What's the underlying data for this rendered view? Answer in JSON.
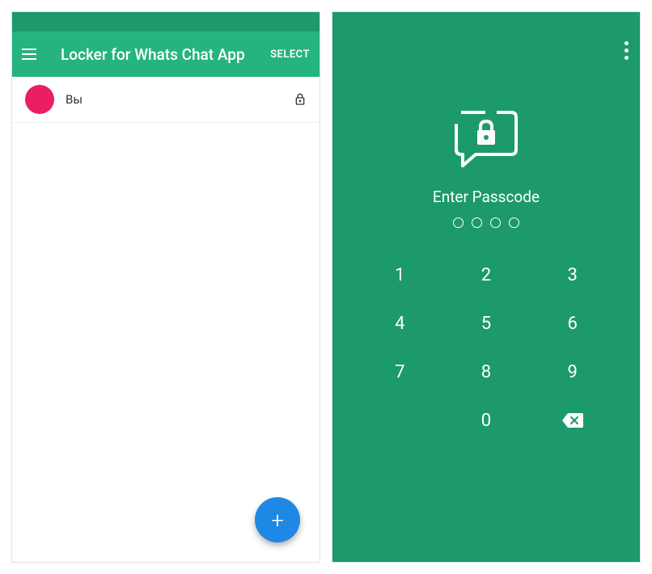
{
  "left": {
    "app_title": "Locker for Whats Chat App",
    "select_label": "SELECT",
    "chat": {
      "name": "Вы"
    },
    "fab_label": "+"
  },
  "right": {
    "prompt": "Enter Passcode",
    "keys": {
      "k1": "1",
      "k2": "2",
      "k3": "3",
      "k4": "4",
      "k5": "5",
      "k6": "6",
      "k7": "7",
      "k8": "8",
      "k9": "9",
      "k0": "0"
    }
  },
  "colors": {
    "primary": "#26b47e",
    "primary_dark": "#1c9a6c",
    "fab": "#1e88e5",
    "avatar": "#e91e63"
  }
}
